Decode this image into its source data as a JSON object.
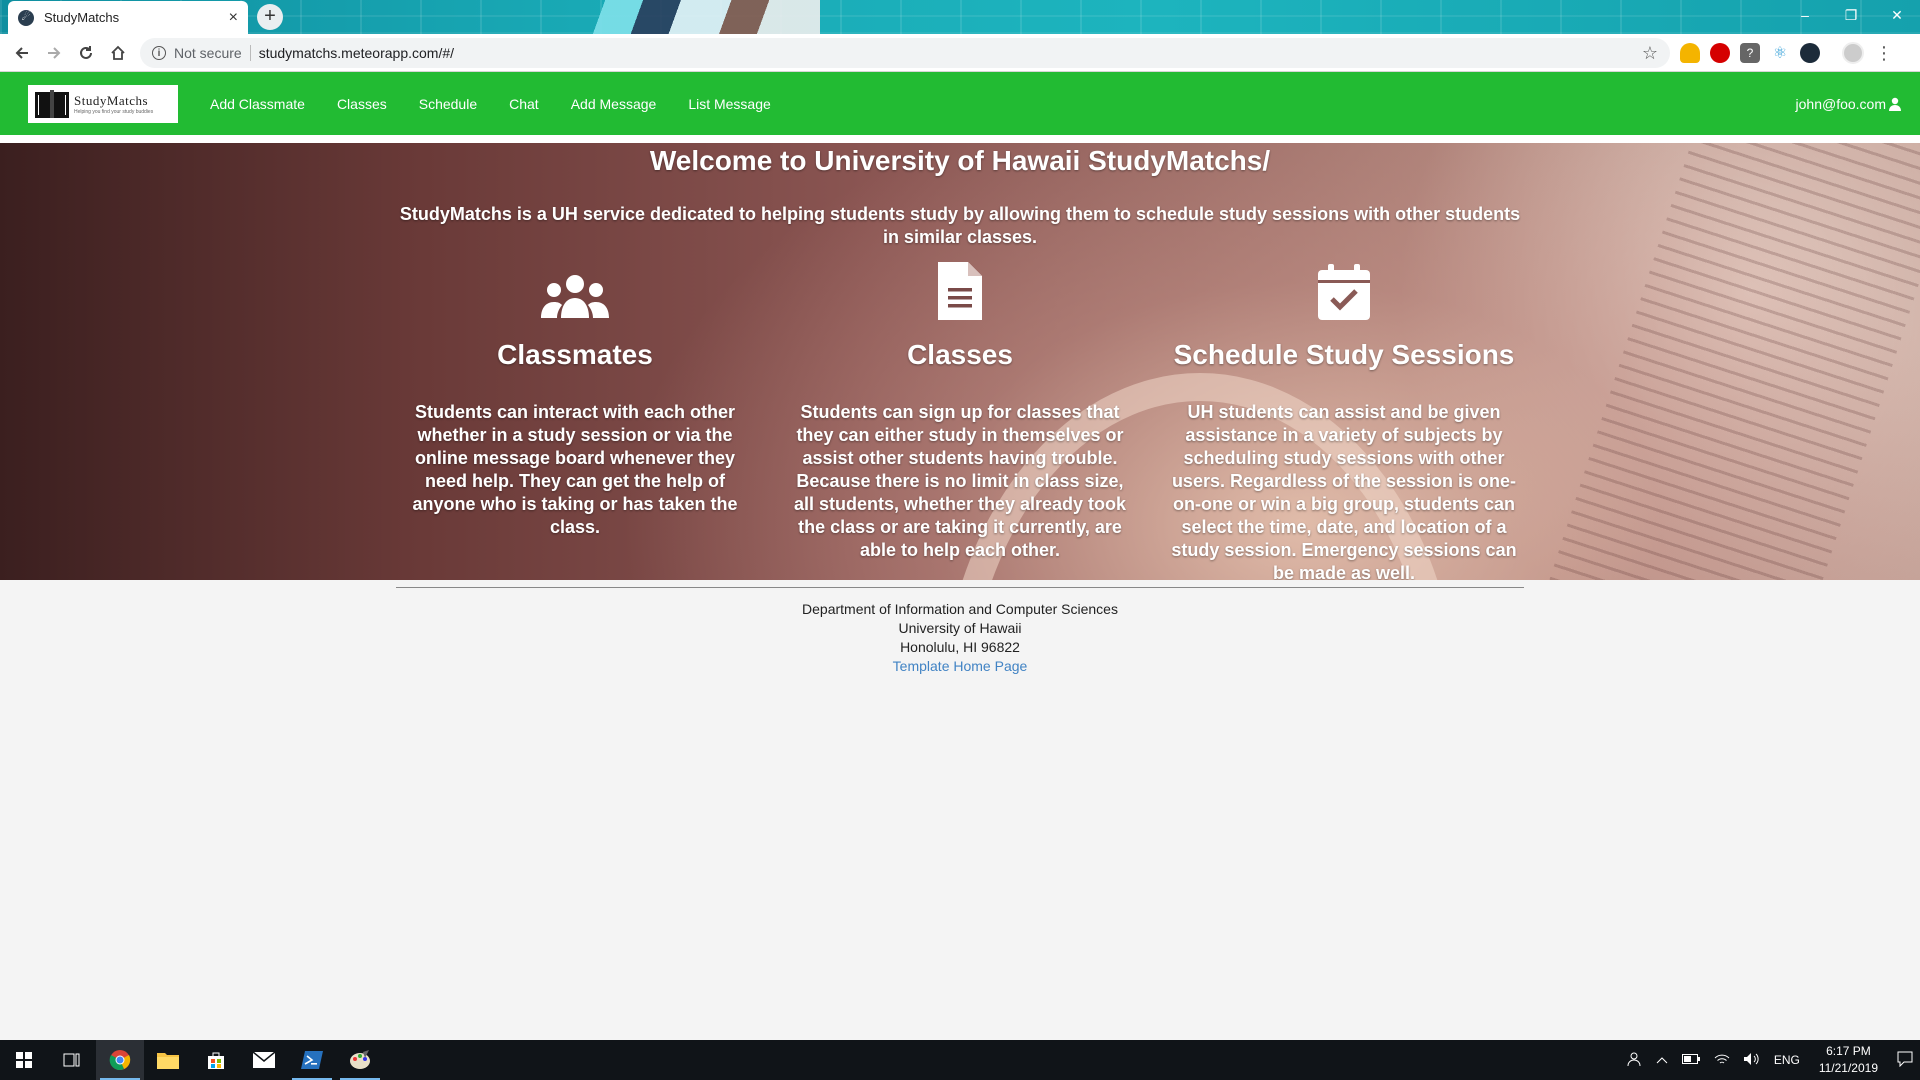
{
  "browser": {
    "tab_title": "StudyMatchs",
    "tab_close": "×",
    "new_tab": "+",
    "security_label": "Not secure",
    "url": "studymatchs.meteorapp.com/#/",
    "window_controls": [
      "–",
      "❐",
      "✕"
    ]
  },
  "nav": {
    "brand_name": "StudyMatchs",
    "brand_tagline": "Helping you find your study buddies",
    "links": [
      "Add Classmate",
      "Classes",
      "Schedule",
      "Chat",
      "Add Message",
      "List Message"
    ],
    "user": "john@foo.com",
    "bg_color": "#22bb33"
  },
  "hero": {
    "title": "Welcome to University of Hawaii StudyMatchs/",
    "intro": "StudyMatchs is a UH service dedicated to helping students study by allowing them to schedule study sessions with other students in similar classes.",
    "features": [
      {
        "icon": "users-icon",
        "title": "Classmates",
        "text": "Students can interact with each other whether in a study session or via the online message board whenever they need help. They can get the help of anyone who is taking or has taken the class."
      },
      {
        "icon": "file-text-icon",
        "title": "Classes",
        "text": "Students can sign up for classes that they can either study in themselves or assist other students having trouble. Because there is no limit in class size, all students, whether they already took the class or are taking it currently, are able to help each other."
      },
      {
        "icon": "calendar-check-icon",
        "title": "Schedule Study Sessions",
        "text": "UH students can assist and be given assistance in a variety of subjects by scheduling study sessions with other users. Regardless of the session is one-on-one or win a big group, students can select the time, date, and location of a study session. Emergency sessions can be made as well."
      }
    ]
  },
  "footer": {
    "line1": "Department of Information and Computer Sciences",
    "line2": "University of Hawaii",
    "line3": "Honolulu, HI 96822",
    "link": "Template Home Page",
    "link_color": "#4183c4"
  },
  "taskbar": {
    "language": "ENG",
    "time": "6:17 PM",
    "date": "11/21/2019"
  }
}
